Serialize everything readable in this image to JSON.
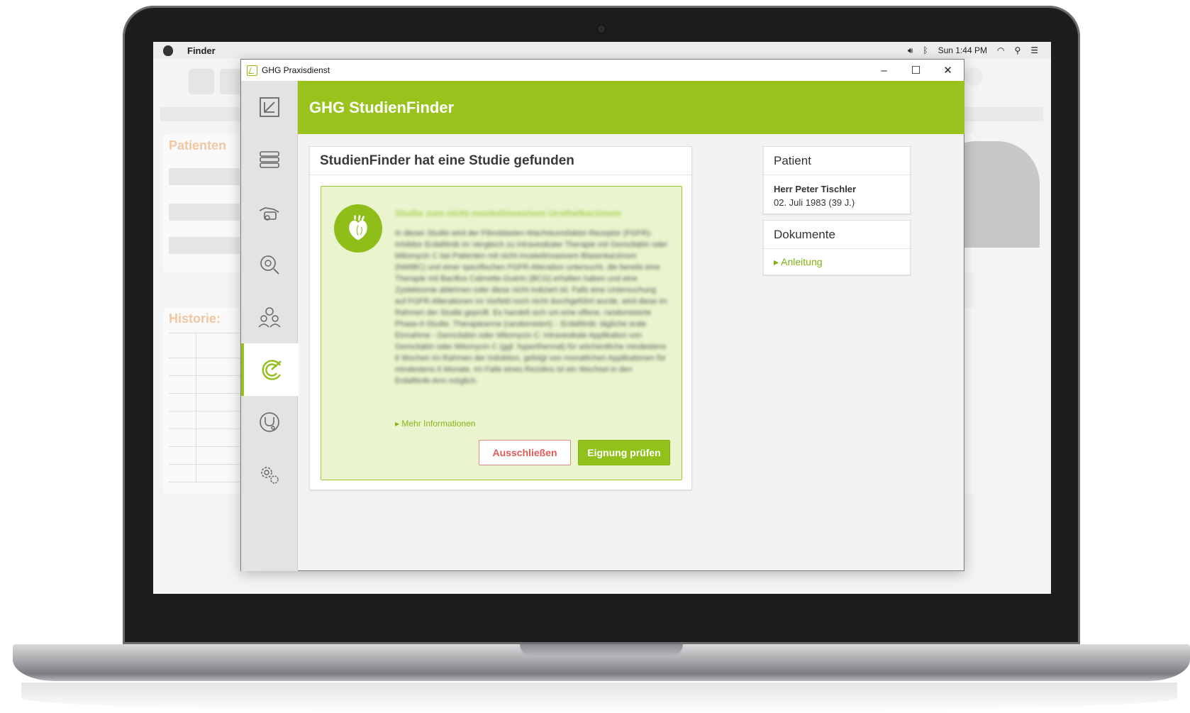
{
  "menubar": {
    "app": "Finder",
    "clock": "Sun 1:44 PM"
  },
  "background_app": {
    "patient_heading": "Patienten",
    "history_heading": "Historie:"
  },
  "window": {
    "title": "GHG Praxisdienst",
    "controls": {
      "minimize": "–",
      "maximize": "☐",
      "close": "✕"
    }
  },
  "header": {
    "title": "GHG StudienFinder"
  },
  "sidebar": {
    "items": [
      {
        "icon": "logo-icon"
      },
      {
        "icon": "list-icon"
      },
      {
        "icon": "payment-hand-icon"
      },
      {
        "icon": "virus-search-icon"
      },
      {
        "icon": "patients-icon"
      },
      {
        "icon": "target-icon",
        "active": true
      },
      {
        "icon": "stethoscope-icon"
      },
      {
        "icon": "settings-icon"
      }
    ]
  },
  "study": {
    "card_title": "StudienFinder hat eine Studie gefunden",
    "title": "Studie zum nicht-muskelinvasiven Urothelkarzinom",
    "body": "In dieser Studie wird der Fibroblasten-Wachstumsfaktor-Rezeptor (FGFR)-Inhibitor Erdafitinib im Vergleich zu intravesikaler Therapie mit Gemcitabin oder Mitomycin C bei Patienten mit nicht-muskelinvasivem Blasenkarzinom (NMIBC) und einer spezifischen FGFR-Alteration untersucht, die bereits eine Therapie mit Bacillus Calmette-Guérin (BCG) erhalten haben und eine Zystektomie ablehnen oder diese nicht indiziert ist. Falls eine Untersuchung auf FGFR-Alterationen im Vorfeld noch nicht durchgeführt wurde, wird diese im Rahmen der Studie geprüft. Es handelt sich um eine offene, randomisierte Phase-II-Studie. Therapiearme (randomisiert): - Erdafitinib: tägliche orale Einnahme - Gemcitabin oder Mitomycin C: intravesikale Applikation von Gemcitabin oder Mitomycin C (ggf. hyperthermal) für wöchentliche mindestens 6 Wochen im Rahmen der Induktion, gefolgt von monatlichen Applikationen für mindestens 6 Monate. Im Falle eines Rezidivs ist ein Wechsel in den Erdafitinib-Arm möglich.",
    "more_info": "Mehr Informationen",
    "exclude_button": "Ausschließen",
    "check_button": "Eignung prüfen"
  },
  "patient": {
    "heading": "Patient",
    "name": "Herr Peter Tischler",
    "birth": "02. Juli 1983 (39 J.)"
  },
  "documents": {
    "heading": "Dokumente",
    "link": "Anleitung"
  },
  "colors": {
    "brand_green": "#99c31c",
    "exclude_red": "#e05a5a"
  }
}
